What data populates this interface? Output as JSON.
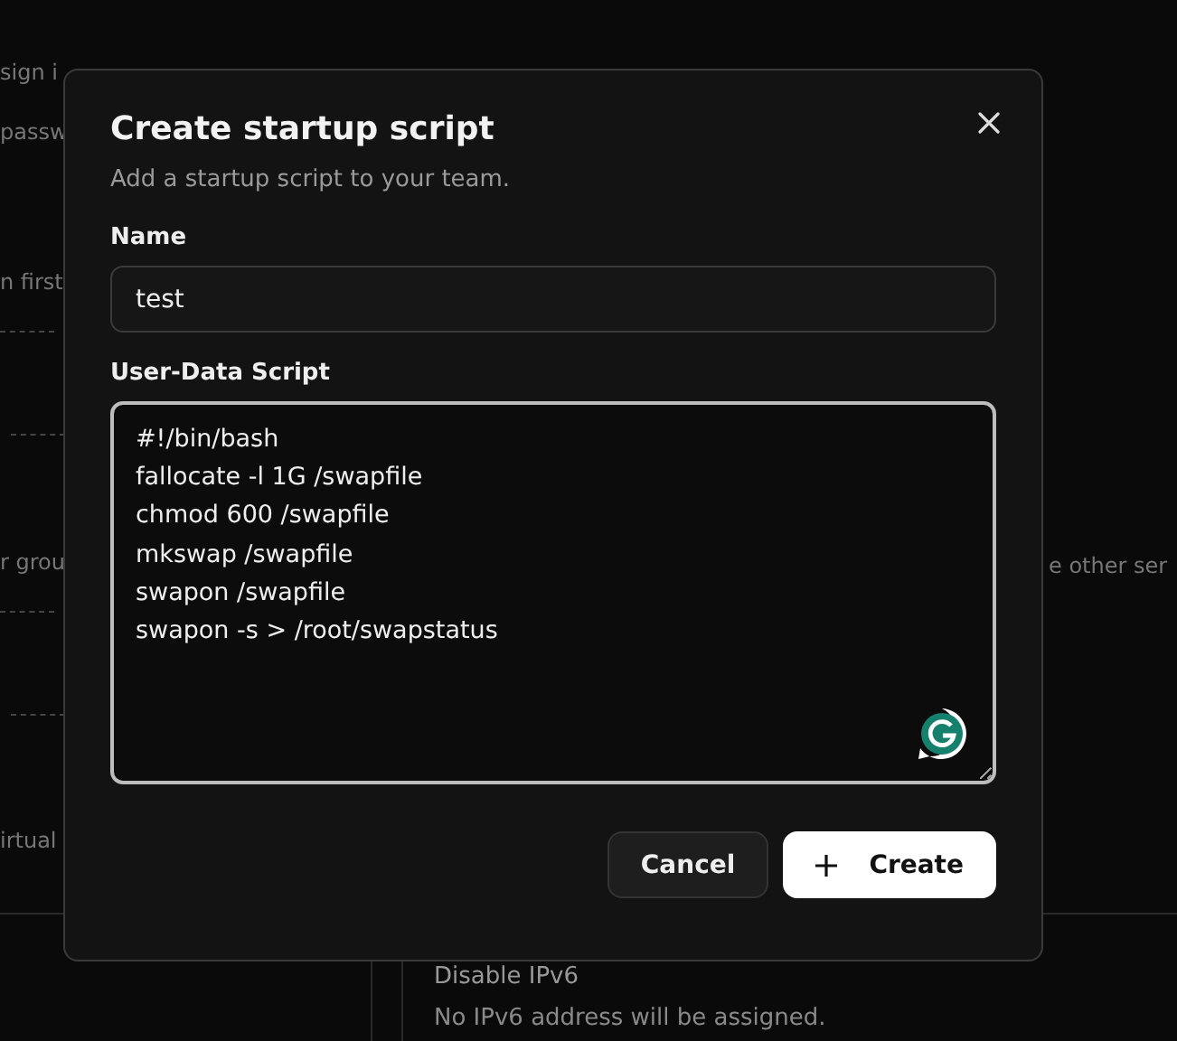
{
  "background": {
    "left_fragments": [
      "sign i",
      "passw",
      "n first",
      "r grou",
      "irtual"
    ],
    "right_fragment": "e other ser",
    "section": {
      "title": "Disable IPv6",
      "description": "No IPv6 address will be assigned."
    }
  },
  "dialog": {
    "title": "Create startup script",
    "subtitle": "Add a startup script to your team.",
    "fields": [
      {
        "kind": "input",
        "label": "Name",
        "value": "test"
      },
      {
        "kind": "textarea",
        "label": "User-Data Script",
        "value": "#!/bin/bash\nfallocate -l 1G /swapfile\nchmod 600 /swapfile\nmkswap /swapfile\nswapon /swapfile\nswapon -s > /root/swapstatus"
      }
    ],
    "buttons": [
      {
        "kind": "secondary",
        "label": "Cancel"
      },
      {
        "kind": "primary",
        "label": "Create"
      }
    ]
  }
}
